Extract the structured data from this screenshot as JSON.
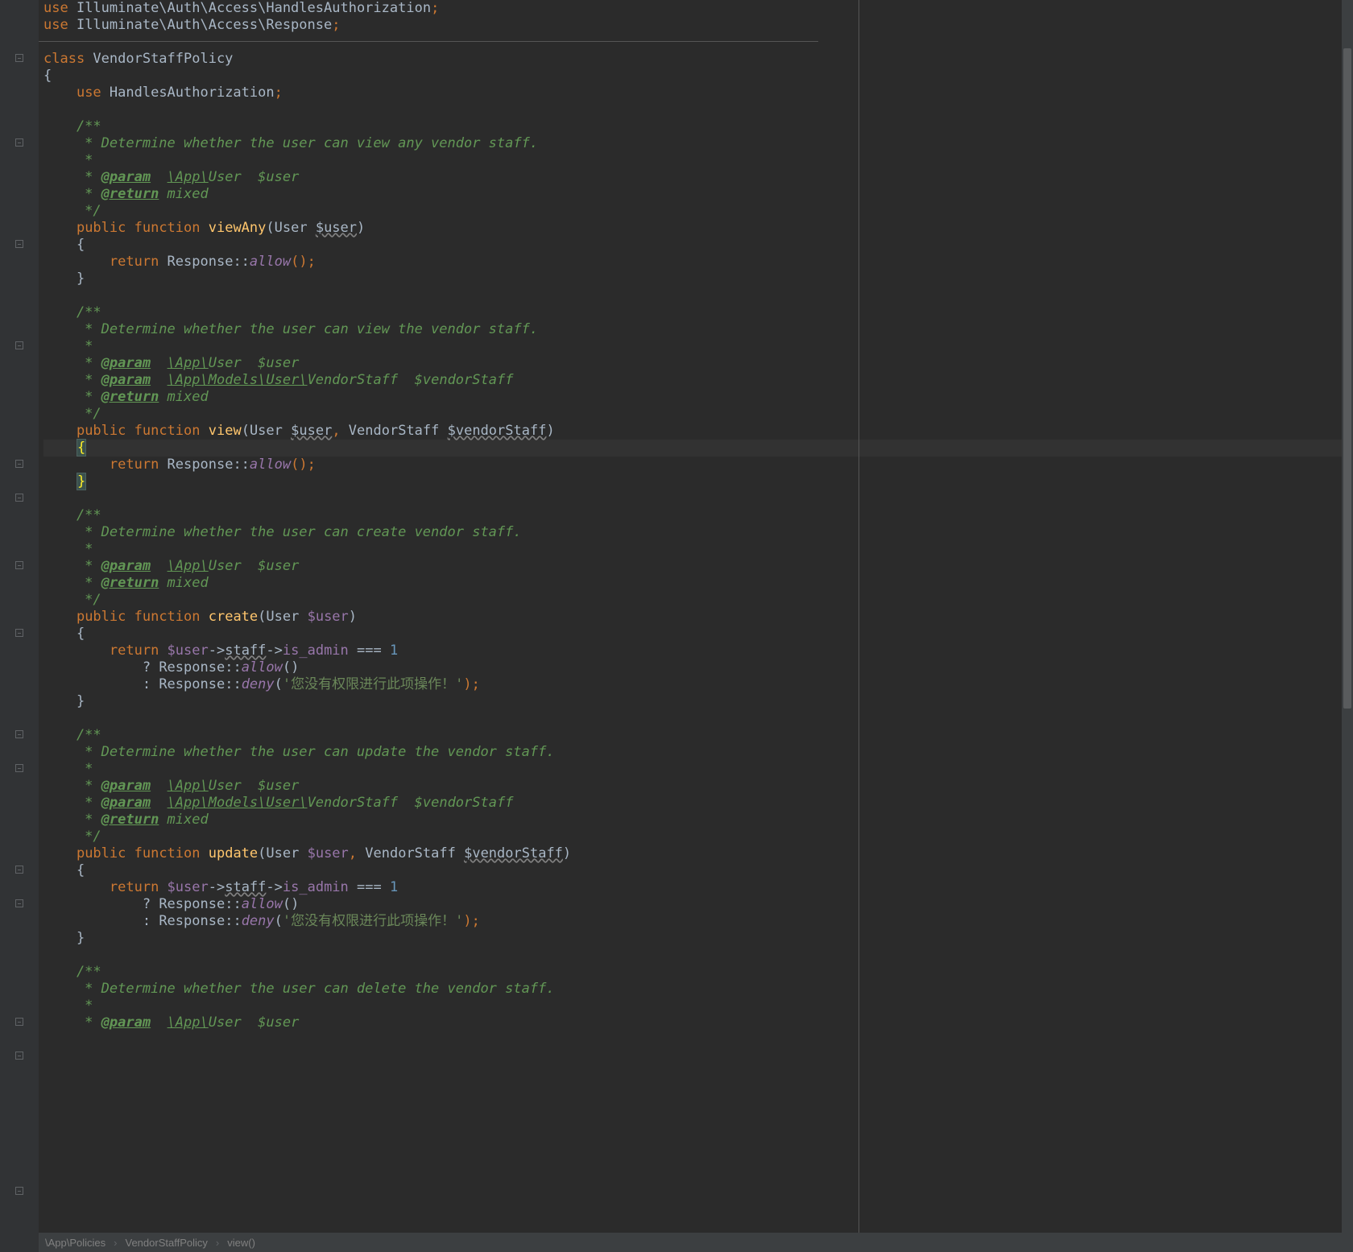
{
  "breadcrumb": {
    "seg1": "\\App\\Policies",
    "seg2": "VendorStaffPolicy",
    "seg3": "view()"
  },
  "code": {
    "l1": {
      "kw1": "use",
      "ns": " Illuminate\\Auth\\Access\\HandlesAuthorization",
      "p": ";"
    },
    "l2": {
      "kw1": "use",
      "ns": " Illuminate\\Auth\\Access\\Response",
      "p": ";"
    },
    "l4": {
      "kw1": "class",
      "name": " VendorStaffPolicy"
    },
    "l5": "{",
    "l6": {
      "indent": "    ",
      "kw1": "use",
      "name": " HandlesAuthorization",
      "p": ";"
    },
    "l8": "    /**",
    "l9": "     * Determine whether the user can view any vendor staff.",
    "l10": "     *",
    "l11": {
      "pre": "     * ",
      "tag": "@param",
      "sp": "  ",
      "type": "\\App\\",
      "typet": "User  ",
      "var": "$user"
    },
    "l12": {
      "pre": "     * ",
      "tag": "@return",
      "t": " mixed"
    },
    "l13": "     */",
    "l14": {
      "kw1": "public",
      "kw2": " function",
      "fn": " viewAny",
      "op1": "(",
      "type": "User ",
      "param": "$user",
      "op2": ")"
    },
    "l15": "    {",
    "l16": {
      "kw": "return",
      "cls": " Response",
      "op": "::",
      "fn": "allow",
      "p": "();"
    },
    "l17": "    }",
    "l19": "    /**",
    "l20": "     * Determine whether the user can view the vendor staff.",
    "l21": "     *",
    "l22": {
      "pre": "     * ",
      "tag": "@param",
      "sp": "  ",
      "type": "\\App\\",
      "typet": "User  ",
      "var": "$user"
    },
    "l23": {
      "pre": "     * ",
      "tag": "@param",
      "sp": "  ",
      "type": "\\App\\Models\\User\\",
      "typet": "VendorStaff  ",
      "var": "$vendorStaff"
    },
    "l24": {
      "pre": "     * ",
      "tag": "@return",
      "t": " mixed"
    },
    "l25": "     */",
    "l26": {
      "kw1": "public",
      "kw2": " function",
      "fn": " view",
      "op1": "(",
      "type1": "User ",
      "param1": "$user",
      "cm": ",",
      "type2": " VendorStaff ",
      "param2": "$vendorStaff",
      "op2": ")"
    },
    "l27": "    {",
    "l28": {
      "kw": "return",
      "cls": " Response",
      "op": "::",
      "fn": "allow",
      "p": "();"
    },
    "l29": "    }",
    "l31": "    /**",
    "l32": "     * Determine whether the user can create vendor staff.",
    "l33": "     *",
    "l34": {
      "pre": "     * ",
      "tag": "@param",
      "sp": "  ",
      "type": "\\App\\",
      "typet": "User  ",
      "var": "$user"
    },
    "l35": {
      "pre": "     * ",
      "tag": "@return",
      "t": " mixed"
    },
    "l36": "     */",
    "l37": {
      "kw1": "public",
      "kw2": " function",
      "fn": " create",
      "op1": "(",
      "type": "User ",
      "param": "$user",
      "op2": ")"
    },
    "l38": "    {",
    "l39": {
      "kw": "return",
      "var": " $user",
      "op1": "->",
      "prop1": "staff",
      "op2": "->",
      "prop2": "is_admin ",
      "eq": "===",
      "num": " 1"
    },
    "l40": {
      "q": "? ",
      "cls": "Response",
      "op": "::",
      "fn": "allow",
      "p": "()"
    },
    "l41": {
      "q": ": ",
      "cls": "Response",
      "op": "::",
      "fn": "deny",
      "p1": "(",
      "str": "'您没有权限进行此项操作！'",
      "p2": ");"
    },
    "l42": "    }",
    "l44": "    /**",
    "l45": "     * Determine whether the user can update the vendor staff.",
    "l46": "     *",
    "l47": {
      "pre": "     * ",
      "tag": "@param",
      "sp": "  ",
      "type": "\\App\\",
      "typet": "User  ",
      "var": "$user"
    },
    "l48": {
      "pre": "     * ",
      "tag": "@param",
      "sp": "  ",
      "type": "\\App\\Models\\User\\",
      "typet": "VendorStaff  ",
      "var": "$vendorStaff"
    },
    "l49": {
      "pre": "     * ",
      "tag": "@return",
      "t": " mixed"
    },
    "l50": "     */",
    "l51": {
      "kw1": "public",
      "kw2": " function",
      "fn": " update",
      "op1": "(",
      "type1": "User ",
      "param1": "$user",
      "cm": ",",
      "type2": " VendorStaff ",
      "param2": "$vendorStaff",
      "op2": ")"
    },
    "l52": "    {",
    "l53": {
      "kw": "return",
      "var": " $user",
      "op1": "->",
      "prop1": "staff",
      "op2": "->",
      "prop2": "is_admin ",
      "eq": "===",
      "num": " 1"
    },
    "l54": {
      "q": "? ",
      "cls": "Response",
      "op": "::",
      "fn": "allow",
      "p": "()"
    },
    "l55": {
      "q": ": ",
      "cls": "Response",
      "op": "::",
      "fn": "deny",
      "p1": "(",
      "str": "'您没有权限进行此项操作！'",
      "p2": ");"
    },
    "l56": "    }",
    "l58": "    /**",
    "l59": "     * Determine whether the user can delete the vendor staff.",
    "l60": "     *",
    "l61": {
      "pre": "     * ",
      "tag": "@param",
      "sp": "  ",
      "type": "\\App\\",
      "typet": "User  ",
      "var": "$user"
    }
  }
}
